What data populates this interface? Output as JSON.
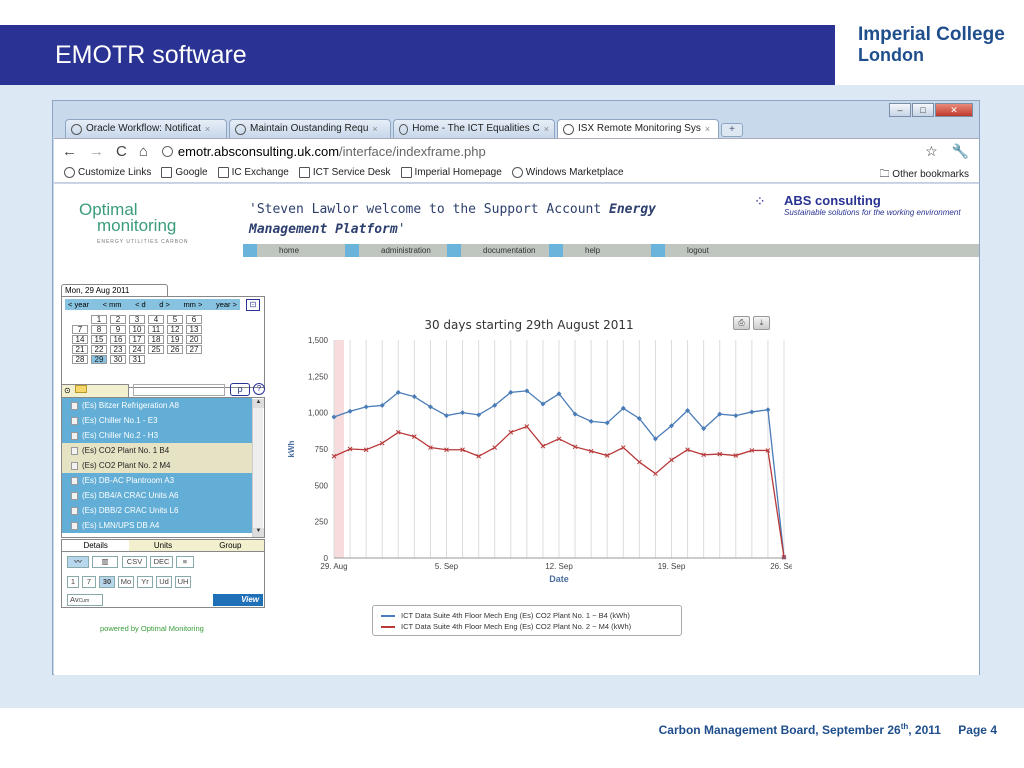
{
  "slide": {
    "title": "EMOTR software",
    "logo_line1": "Imperial College",
    "logo_line2": "London",
    "footer_main": "Carbon Management Board, September 26",
    "footer_sup": "th",
    "footer_year": ", 2011",
    "footer_page": "Page 4"
  },
  "browser": {
    "tabs": [
      {
        "label": "Oracle Workflow: Notificat"
      },
      {
        "label": "Maintain Oustanding Requ"
      },
      {
        "label": "Home - The ICT Equalities C"
      },
      {
        "label": "ISX Remote Monitoring Sys"
      }
    ],
    "active_tab": 3,
    "new_tab": "+",
    "address_host": "emotr.absconsulting.uk.com",
    "address_path": "/interface/indexframe.php",
    "bookmarks": [
      "Customize Links",
      "Google",
      "IC Exchange",
      "ICT Service Desk",
      "Imperial Homepage",
      "Windows Marketplace"
    ],
    "other_bookmarks": "Other bookmarks"
  },
  "page": {
    "om_logo_1": "Optimal",
    "om_logo_2": "monitoring",
    "om_logo_sub": "ENERGY UTILITIES CARBON",
    "welcome_1": "'Steven Lawlor welcome to the Support Account ",
    "welcome_1b": "Energy",
    "welcome_2": "Management Platform",
    "welcome_2b": "'",
    "abs_name": "ABS consulting",
    "abs_tag": "Sustainable solutions for the working environment",
    "menu": [
      "home",
      "administration",
      "documentation",
      "help",
      "logout"
    ]
  },
  "calendar": {
    "tab": "Mon, 29 Aug 2011",
    "nav": [
      "< year",
      "< mm",
      "< d",
      "d >",
      "mm >",
      "year >"
    ],
    "rows": [
      [
        "",
        "1",
        "2",
        "3",
        "4",
        "5",
        "6"
      ],
      [
        "7",
        "8",
        "9",
        "10",
        "11",
        "12",
        "13"
      ],
      [
        "14",
        "15",
        "16",
        "17",
        "18",
        "19",
        "20"
      ],
      [
        "21",
        "22",
        "23",
        "24",
        "25",
        "26",
        "27"
      ],
      [
        "28",
        "29",
        "30",
        "31",
        "",
        "",
        ""
      ]
    ],
    "selected": "29"
  },
  "search": {
    "button": "ρ",
    "help": "?"
  },
  "list": [
    {
      "label": "(Es) Bitzer Refrigeration  A8",
      "sel": false
    },
    {
      "label": "(Es) Chiller No.1 - E3",
      "sel": false
    },
    {
      "label": "(Es) Chiller No.2 - H3",
      "sel": false
    },
    {
      "label": "(Es) CO2 Plant No. 1  B4",
      "sel": true
    },
    {
      "label": "(Es) CO2 Plant No. 2  M4",
      "sel": true
    },
    {
      "label": "(Es) DB-AC Plantroom  A3",
      "sel": false
    },
    {
      "label": "(Es) DB4/A CRAC Units  A6",
      "sel": false
    },
    {
      "label": "(Es) DBB/2 CRAC Units  L6",
      "sel": false
    },
    {
      "label": "(Es) LMN/UPS DB  A4",
      "sel": false
    }
  ],
  "details": {
    "tabs": [
      "Details",
      "Units",
      "Group"
    ],
    "buttons_row1": [
      "CSV",
      "DEC"
    ],
    "periods": [
      "1",
      "7",
      "30",
      "Mo",
      "Yr",
      "Ud",
      "UH"
    ],
    "selected_period": "30",
    "avg": "Av",
    "avg2": "Cum",
    "view": "View",
    "powered": "powered by Optimal Monitoring"
  },
  "chart_data": {
    "type": "line",
    "title": "30 days starting 29th August 2011",
    "xlabel": "Date",
    "ylabel": "kWh",
    "ylim": [
      0,
      1500
    ],
    "yticks": [
      0,
      250,
      500,
      750,
      "1,000",
      "1,250",
      "1,500"
    ],
    "xtick_labels": [
      "29. Aug",
      "5. Sep",
      "12. Sep",
      "19. Sep",
      "26. Sep"
    ],
    "xtick_days": [
      0,
      7,
      14,
      21,
      28
    ],
    "series": [
      {
        "name": "ICT Data Suite 4th Floor Mech Eng (Es) CO2 Plant No. 1 ~ B4 (kWh)",
        "color": "#4a7cb8",
        "marker": "diamond",
        "values": [
          970,
          1010,
          1040,
          1050,
          1140,
          1110,
          1040,
          980,
          1000,
          985,
          1050,
          1140,
          1150,
          1060,
          1130,
          990,
          940,
          930,
          1030,
          960,
          820,
          910,
          1015,
          890,
          990,
          980,
          1005,
          1020,
          5
        ]
      },
      {
        "name": "ICT Data Suite 4th Floor Mech Eng (Es) CO2 Plant No. 2 ~ M4 (kWh)",
        "color": "#b8393a",
        "marker": "x",
        "values": [
          700,
          750,
          745,
          790,
          865,
          835,
          760,
          745,
          745,
          700,
          760,
          865,
          905,
          770,
          820,
          765,
          735,
          705,
          760,
          660,
          580,
          675,
          745,
          710,
          715,
          705,
          740,
          740,
          5
        ]
      }
    ]
  }
}
